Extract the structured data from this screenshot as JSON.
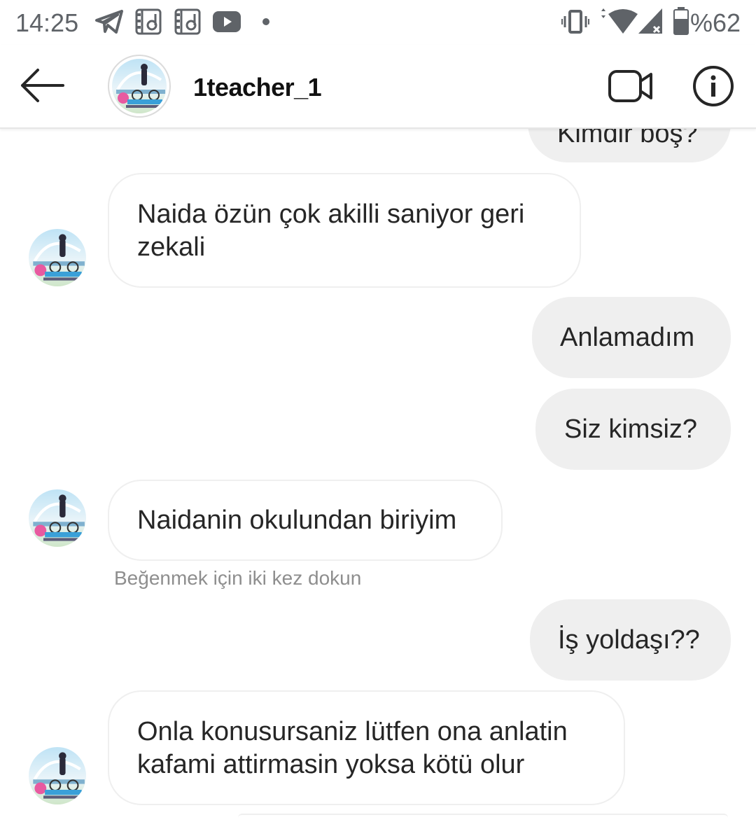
{
  "status_bar": {
    "time": "14:25",
    "battery": "%62",
    "icons": [
      "telegram-icon",
      "film-icon",
      "film-icon",
      "youtube-icon",
      "dot-icon",
      "vibrate-icon",
      "wifi-icon",
      "signal-icon",
      "battery-icon"
    ]
  },
  "header": {
    "username": "1teacher_1",
    "icons": [
      "back-arrow-icon",
      "video-call-icon",
      "info-icon"
    ]
  },
  "messages": [
    {
      "side": "out",
      "text": "Kimdir boş?"
    },
    {
      "side": "in",
      "lines": [
        "Naida özün çok akilli saniyor geri",
        "zekali"
      ]
    },
    {
      "side": "out",
      "text": "Anlamadım"
    },
    {
      "side": "out",
      "text": "Siz kimsiz?"
    },
    {
      "side": "in",
      "text": "Naidanin okulundan biriyim"
    },
    {
      "side": "out",
      "text": "İş yoldaşı??"
    },
    {
      "side": "in",
      "lines": [
        "Onla konusursaniz lütfen ona anlatin",
        "kafami attirmasin yoksa kötü olur"
      ]
    }
  ],
  "hint": "Beğenmek için iki kez dokun",
  "colors": {
    "outgoing_bubble": "#efefef",
    "incoming_border": "#efefef",
    "hint": "#8e8e8e"
  }
}
